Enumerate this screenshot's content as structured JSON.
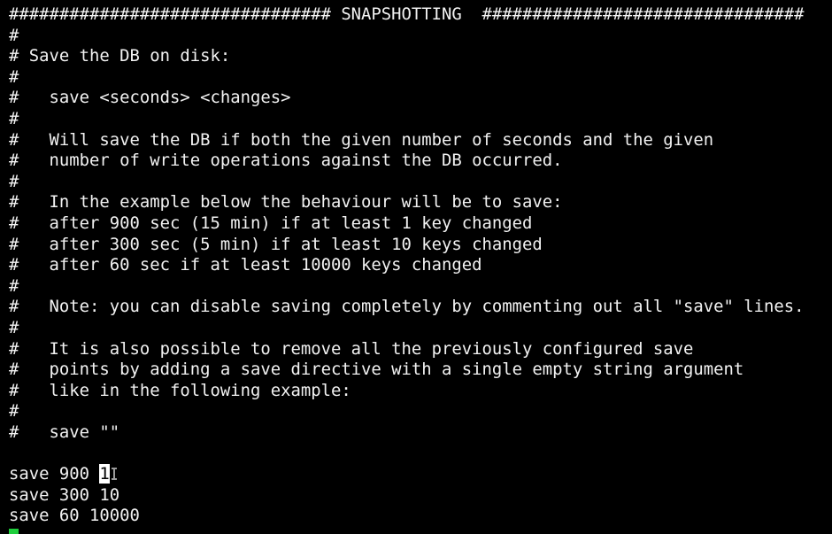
{
  "editor": {
    "lines": [
      "################################ SNAPSHOTTING  ################################",
      "#",
      "# Save the DB on disk:",
      "#",
      "#   save <seconds> <changes>",
      "#",
      "#   Will save the DB if both the given number of seconds and the given",
      "#   number of write operations against the DB occurred.",
      "#",
      "#   In the example below the behaviour will be to save:",
      "#   after 900 sec (15 min) if at least 1 key changed",
      "#   after 300 sec (5 min) if at least 10 keys changed",
      "#   after 60 sec if at least 10000 keys changed",
      "#",
      "#   Note: you can disable saving completely by commenting out all \"save\" lines.",
      "#",
      "#   It is also possible to remove all the previously configured save",
      "#   points by adding a save directive with a single empty string argument",
      "#   like in the following example:",
      "#",
      "#   save \"\"",
      ""
    ],
    "cursor_line": {
      "before": "save 900 ",
      "cursor_char": "1",
      "after": ""
    },
    "trailing_lines": [
      "save 300 10",
      "save 60 10000"
    ]
  },
  "colors": {
    "background": "#000000",
    "foreground": "#f2f2f2",
    "cursor_block": "#ffffff",
    "input_cursor": "#1fce3c"
  }
}
